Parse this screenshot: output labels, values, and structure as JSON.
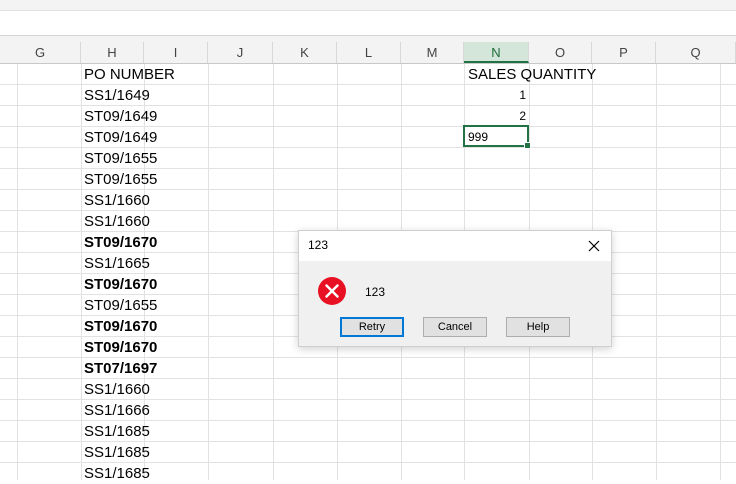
{
  "columns": [
    "G",
    "H",
    "I",
    "J",
    "K",
    "L",
    "M",
    "N",
    "O",
    "P",
    "Q"
  ],
  "selected_column": "N",
  "headers": {
    "po_number": "PO NUMBER",
    "sales_quantity": "SALES QUANTITY"
  },
  "po_numbers": [
    {
      "text": "SS1/1649",
      "bold": false
    },
    {
      "text": "ST09/1649",
      "bold": false
    },
    {
      "text": "ST09/1649",
      "bold": false
    },
    {
      "text": "ST09/1655",
      "bold": false
    },
    {
      "text": "ST09/1655",
      "bold": false
    },
    {
      "text": "SS1/1660",
      "bold": false
    },
    {
      "text": "SS1/1660",
      "bold": false
    },
    {
      "text": "ST09/1670",
      "bold": true
    },
    {
      "text": "SS1/1665",
      "bold": false
    },
    {
      "text": "ST09/1670",
      "bold": true
    },
    {
      "text": "ST09/1655",
      "bold": false
    },
    {
      "text": "ST09/1670",
      "bold": true
    },
    {
      "text": "ST09/1670",
      "bold": true
    },
    {
      "text": "ST07/1697",
      "bold": true
    },
    {
      "text": "SS1/1660",
      "bold": false
    },
    {
      "text": "SS1/1666",
      "bold": false
    },
    {
      "text": "SS1/1685",
      "bold": false
    },
    {
      "text": "SS1/1685",
      "bold": false
    },
    {
      "text": "SS1/1685",
      "bold": false
    }
  ],
  "sales_values": [
    "1",
    "2"
  ],
  "active_cell_value": "999",
  "dialog": {
    "title": "123",
    "message": "123",
    "buttons": {
      "retry": "Retry",
      "cancel": "Cancel",
      "help": "Help"
    },
    "close_icon": "close-icon",
    "error_icon": "error-icon"
  },
  "colors": {
    "accent_green": "#217346",
    "error_red": "#e81123",
    "default_button_border": "#0078d7"
  }
}
